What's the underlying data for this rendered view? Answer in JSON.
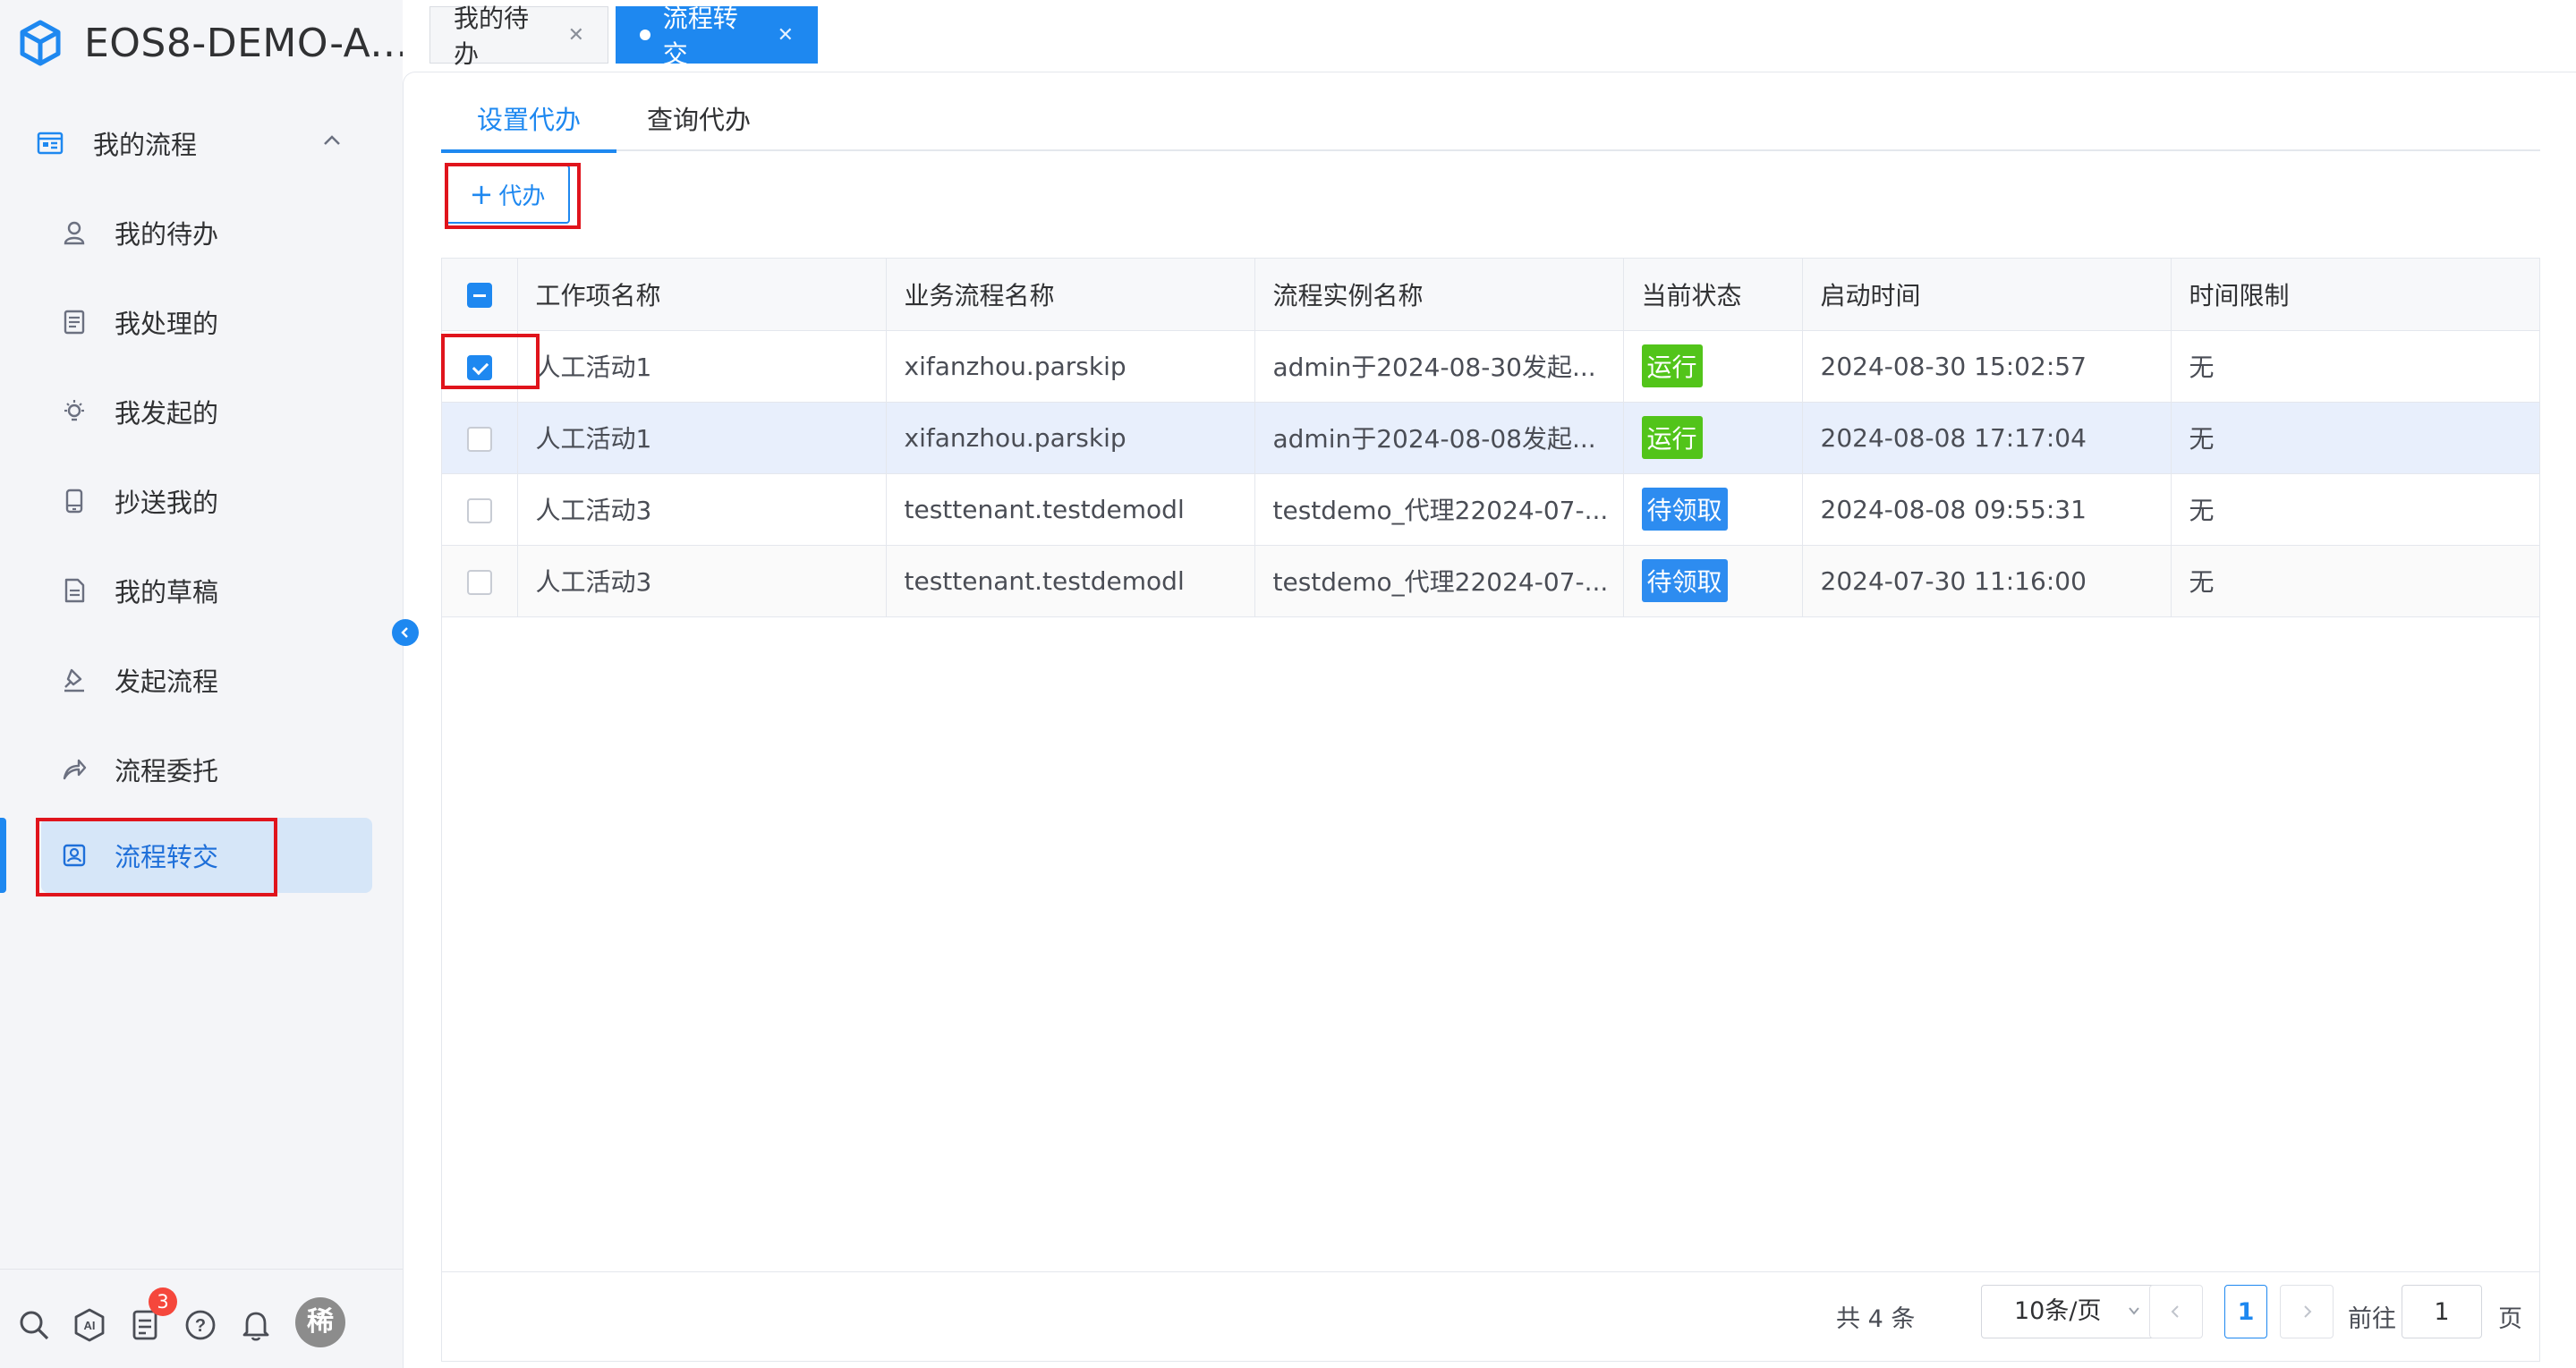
{
  "app": {
    "title": "EOS8-DEMO-A..."
  },
  "sidebar": {
    "group_label": "我的流程",
    "items": [
      {
        "label": "我的待办",
        "icon": "user-icon"
      },
      {
        "label": "我处理的",
        "icon": "document-icon"
      },
      {
        "label": "我发起的",
        "icon": "lightbulb-icon"
      },
      {
        "label": "抄送我的",
        "icon": "phone-icon"
      },
      {
        "label": "我的草稿",
        "icon": "draft-icon"
      },
      {
        "label": "发起流程",
        "icon": "stamp-icon"
      },
      {
        "label": "流程委托",
        "icon": "share-icon"
      },
      {
        "label": "流程转交",
        "icon": "transfer-icon",
        "active": true
      }
    ],
    "notification_count": "3",
    "avatar_text": "稀"
  },
  "tabs": [
    {
      "label": "我的待办",
      "active": false
    },
    {
      "label": "流程转交",
      "active": true
    }
  ],
  "subtabs": [
    {
      "label": "设置代办",
      "active": true
    },
    {
      "label": "查询代办",
      "active": false
    }
  ],
  "toolbar": {
    "add_label": "代办"
  },
  "table": {
    "columns": [
      "工作项名称",
      "业务流程名称",
      "流程实例名称",
      "当前状态",
      "启动时间",
      "时间限制"
    ],
    "rows": [
      {
        "checked": true,
        "work_item": "人工活动1",
        "business": "xifanzhou.parskip",
        "instance": "admin于2024-08-30发起...",
        "status": "运行",
        "status_color": "#52c41a",
        "start": "2024-08-30 15:02:57",
        "limit": "无"
      },
      {
        "checked": false,
        "work_item": "人工活动1",
        "business": "xifanzhou.parskip",
        "instance": "admin于2024-08-08发起...",
        "status": "运行",
        "status_color": "#52c41a",
        "start": "2024-08-08 17:17:04",
        "limit": "无"
      },
      {
        "checked": false,
        "work_item": "人工活动3",
        "business": "testtenant.testdemodl",
        "instance": "testdemo_代理22024-07-...",
        "status": "待领取",
        "status_color": "#2d8cf0",
        "start": "2024-08-08 09:55:31",
        "limit": "无"
      },
      {
        "checked": false,
        "work_item": "人工活动3",
        "business": "testtenant.testdemodl",
        "instance": "testdemo_代理22024-07-...",
        "status": "待领取",
        "status_color": "#2d8cf0",
        "start": "2024-07-30 11:16:00",
        "limit": "无"
      }
    ]
  },
  "pagination": {
    "total_text": "共 4 条",
    "page_size": "10条/页",
    "current_page": "1",
    "goto_label": "前往",
    "goto_value": "1",
    "page_unit": "页"
  },
  "colors": {
    "accent": "#1e88f0",
    "highlight_annotation": "#e0141c"
  }
}
